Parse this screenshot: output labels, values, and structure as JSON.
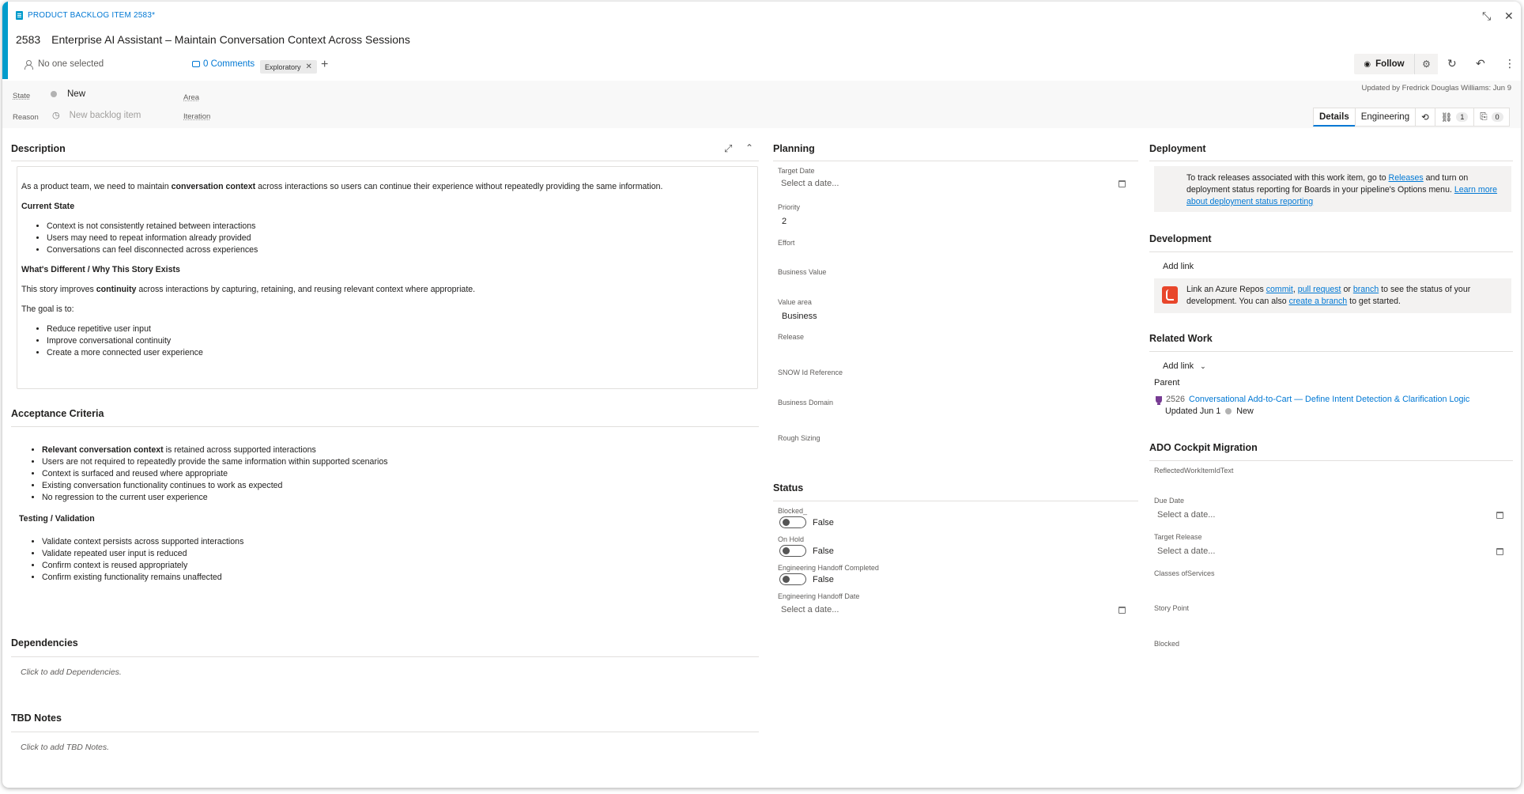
{
  "header": {
    "work_item_type": "PRODUCT BACKLOG ITEM 2583*",
    "id": "2583",
    "title": "Enterprise AI Assistant – Maintain Conversation Context Across Sessions",
    "assigned": "No one selected",
    "comments": "0 Comments",
    "tags": [
      "Exploratory"
    ],
    "add_tag": "+",
    "follow_label": "Follow",
    "updated": "Updated by Fredrick Douglas Williams: Jun 9",
    "icons": {
      "minimize": "collapse-icon",
      "close": "close-icon",
      "refresh": "refresh-icon",
      "undo": "undo-icon",
      "more": "more-icon",
      "settings": "gear-icon"
    },
    "accent_color": "#009ccc"
  },
  "fields": {
    "state_label": "State",
    "state_value": "New",
    "reason_label": "Reason",
    "reason_value": "New backlog item",
    "area_label": "Area",
    "iteration_label": "Iteration"
  },
  "tabs": {
    "details": "Details",
    "engineering": "Engineering",
    "links_count": "1",
    "attachments_count": "0"
  },
  "description": {
    "heading": "Description",
    "intro_pre": "As a product team, we need to maintain ",
    "intro_bold": "conversation context",
    "intro_post": " across interactions so users can continue their experience without repeatedly providing the same information.",
    "current_state_heading": "Current State",
    "current_state": [
      "Context is not consistently retained between interactions",
      "Users may need to repeat information already provided",
      "Conversations can feel disconnected across experiences"
    ],
    "different_heading": "What's Different / Why This Story Exists",
    "story_pre": "This story improves ",
    "story_bold": "continuity",
    "story_post": " across interactions by capturing, retaining, and reusing relevant context where appropriate.",
    "goal_intro": "The goal is to:",
    "goals": [
      "Reduce repetitive user input",
      "Improve conversational continuity",
      "Create a more connected user experience"
    ]
  },
  "acceptance": {
    "heading": "Acceptance Criteria",
    "first_bold": "Relevant conversation context",
    "first_rest": " is retained across supported interactions",
    "items": [
      "Users are not required to repeatedly provide the same information within supported scenarios",
      "Context is surfaced and reused where appropriate",
      "Existing conversation functionality continues to work as expected",
      "No regression to the current user experience"
    ],
    "testing_heading": "Testing / Validation",
    "testing": [
      "Validate context persists across supported interactions",
      "Validate repeated user input is reduced",
      "Confirm context is reused appropriately",
      "Confirm existing functionality remains unaffected"
    ]
  },
  "dependencies": {
    "heading": "Dependencies",
    "placeholder": "Click to add Dependencies."
  },
  "tbd": {
    "heading": "TBD Notes",
    "placeholder": "Click to add TBD Notes."
  },
  "planning": {
    "heading": "Planning",
    "target_date_label": "Target Date",
    "date_placeholder": "Select a date...",
    "priority_label": "Priority",
    "priority_value": "2",
    "effort_label": "Effort",
    "business_value_label": "Business Value",
    "value_area_label": "Value area",
    "value_area_value": "Business",
    "release_label": "Release",
    "snow_label": "SNOW Id Reference",
    "business_domain_label": "Business Domain",
    "rough_sizing_label": "Rough Sizing"
  },
  "status": {
    "heading": "Status",
    "blocked_label": "Blocked_",
    "on_hold_label": "On Hold",
    "handoff_completed_label": "Engineering Handoff Completed",
    "false_text": "False",
    "handoff_date_label": "Engineering Handoff Date",
    "date_placeholder": "Select a date..."
  },
  "deployment": {
    "heading": "Deployment",
    "text_1": "To track releases associated with this work item, go to ",
    "releases_link": "Releases",
    "text_2": " and turn on deployment status reporting for Boards in your pipeline's Options menu. ",
    "learn_link": "Learn more about deployment status reporting"
  },
  "development": {
    "heading": "Development",
    "add_link": "Add link",
    "text_1": "Link an Azure Repos ",
    "commit": "commit",
    "comma": ", ",
    "pull_request": "pull request",
    "or": " or ",
    "branch": "branch",
    "text_2": " to see the status of your development. You can also ",
    "create_branch": "create a branch",
    "text_3": " to get started."
  },
  "related": {
    "heading": "Related Work",
    "add_link": "Add link",
    "parent_label": "Parent",
    "parent_id": "2526",
    "parent_title": "Conversational Add-to-Cart — Define Intent Detection & Clarification Logic",
    "parent_updated": "Updated Jun 1",
    "parent_state": "New"
  },
  "ado": {
    "heading": "ADO Cockpit Migration",
    "reflected_label": "ReflectedWorkItemIdText",
    "due_date_label": "Due Date",
    "target_release_label": "Target Release",
    "date_placeholder": "Select a date...",
    "classes_label": "Classes ofServices",
    "story_point_label": "Story Point",
    "blocked_label": "Blocked"
  }
}
